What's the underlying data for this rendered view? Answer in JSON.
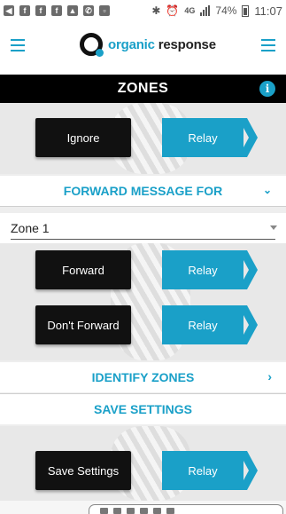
{
  "status_bar": {
    "network": "4G",
    "battery": "74%",
    "time": "11:07"
  },
  "header": {
    "logo_word1": "organic",
    "logo_word2": "response"
  },
  "title_bar": {
    "title": "ZONES",
    "info_icon": "i"
  },
  "ignore_row": {
    "action_label": "Ignore",
    "relay_label": "Relay"
  },
  "forward_section": {
    "heading": "FORWARD MESSAGE FOR",
    "chevron": "⌄"
  },
  "zone_dropdown": {
    "selected": "Zone 1"
  },
  "forward_row": {
    "action_label": "Forward",
    "relay_label": "Relay"
  },
  "dont_forward_row": {
    "action_label": "Don't Forward",
    "relay_label": "Relay"
  },
  "identify_section": {
    "heading": "IDENTIFY ZONES",
    "chevron": "›"
  },
  "save_section": {
    "heading": "SAVE SETTINGS"
  },
  "save_row": {
    "action_label": "Save Settings",
    "relay_label": "Relay"
  },
  "colors": {
    "accent": "#1aa0c8",
    "dark": "#111111",
    "panel": "#e8e8e8"
  }
}
